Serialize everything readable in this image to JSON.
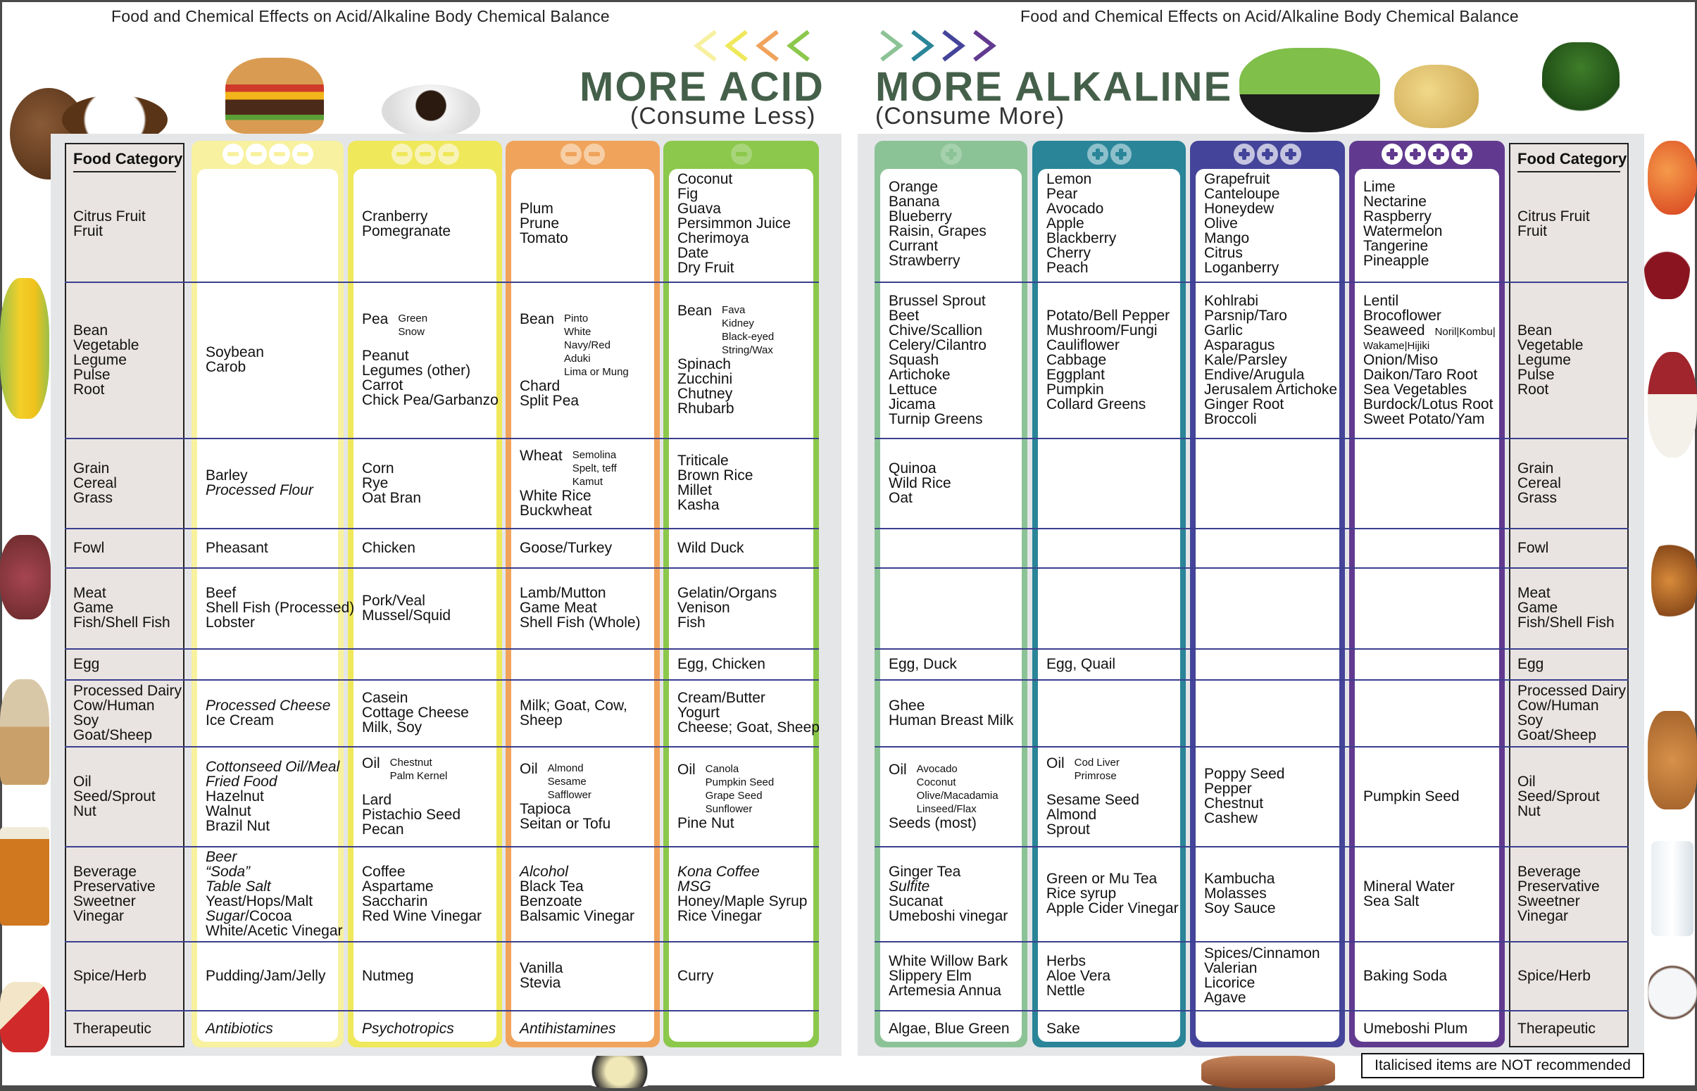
{
  "title": "Food and Chemical Effects on Acid/Alkaline Body Chemical Balance",
  "acid_side": {
    "heading": "MORE ACID",
    "subheading": "(Consume Less)",
    "chevron_colors": [
      "#f7f0a0",
      "#efe85a",
      "#f0a35b",
      "#8cc84b"
    ]
  },
  "alkaline_side": {
    "heading": "MORE ALKALINE",
    "subheading": "(Consume More)",
    "chevron_colors": [
      "#8cc396",
      "#2a8598",
      "#44449a",
      "#613a8f"
    ]
  },
  "category_header": "Food Category",
  "categories": [
    [
      "Citrus Fruit",
      "Fruit"
    ],
    [
      "Bean",
      "Vegetable",
      "Legume",
      "Pulse",
      "Root"
    ],
    [
      "Grain",
      "Cereal",
      "Grass"
    ],
    [
      "Fowl"
    ],
    [
      "Meat",
      "Game",
      "Fish/Shell Fish"
    ],
    [
      "Egg"
    ],
    [
      "Processed Dairy",
      "Cow/Human",
      "Soy",
      "Goat/Sheep"
    ],
    [
      "Oil",
      "Seed/Sprout",
      "Nut"
    ],
    [
      "Beverage",
      "Preservative",
      "Sweetner",
      "Vinegar"
    ],
    [
      "Spice/Herb"
    ],
    [
      "Therapeutic"
    ]
  ],
  "columns": [
    {
      "id": "acid-4",
      "sign": "minus",
      "level": 4,
      "color": "#f8f19f",
      "icon_bg": "#ffffff",
      "icon_fg": "#f8f19f",
      "cells": [
        [],
        [
          {
            "t": "Soybean"
          },
          {
            "t": "Carob"
          }
        ],
        [
          {
            "t": "Barley"
          },
          {
            "t": "Processed Flour",
            "i": true
          }
        ],
        [
          {
            "t": "Pheasant"
          }
        ],
        [
          {
            "t": "Beef"
          },
          {
            "t": "Shell Fish (Processed)"
          },
          {
            "t": "Lobster"
          }
        ],
        [],
        [
          {
            "t": "Processed Cheese",
            "i": true
          },
          {
            "t": "Ice Cream"
          }
        ],
        [
          {
            "t": "Cottonseed Oil/Meal",
            "i": true
          },
          {
            "t": "Fried Food",
            "i": true
          },
          {
            "t": "Hazelnut"
          },
          {
            "t": "Walnut"
          },
          {
            "t": "Brazil Nut"
          }
        ],
        [
          {
            "t": "Beer",
            "i": true
          },
          {
            "t": "“Soda”",
            "i": true
          },
          {
            "t": "Table Salt",
            "i": true
          },
          {
            "t": "Yeast/Hops/Malt"
          },
          {
            "t": "Sugar",
            "i": true,
            "rest": "/Cocoa"
          },
          {
            "t": "White/Acetic Vinegar"
          }
        ],
        [
          {
            "t": "Pudding/Jam/Jelly"
          }
        ],
        [
          {
            "t": "Antibiotics",
            "i": true
          }
        ]
      ]
    },
    {
      "id": "acid-3",
      "sign": "minus",
      "level": 3,
      "color": "#efe85a",
      "icon_bg": "#f8f3b8",
      "icon_fg": "#efe85a",
      "cells": [
        [
          {
            "t": "Cranberry"
          },
          {
            "t": "Pomegranate"
          }
        ],
        [
          {
            "t": "Pea",
            "sub": [
              "Green",
              "Snow"
            ]
          },
          {
            "t": ""
          },
          {
            "t": "Peanut"
          },
          {
            "t": "Legumes (other)"
          },
          {
            "t": "Carrot"
          },
          {
            "t": "Chick Pea/Garbanzo"
          }
        ],
        [
          {
            "t": "Corn"
          },
          {
            "t": "Rye"
          },
          {
            "t": "Oat Bran"
          }
        ],
        [
          {
            "t": "Chicken"
          }
        ],
        [
          {
            "t": "Pork/Veal"
          },
          {
            "t": "Mussel/Squid"
          }
        ],
        [],
        [
          {
            "t": "Casein"
          },
          {
            "t": "Cottage Cheese"
          },
          {
            "t": "Milk, Soy"
          }
        ],
        [
          {
            "t": "Oil",
            "sub": [
              "Chestnut",
              "Palm Kernel"
            ]
          },
          {
            "t": ""
          },
          {
            "t": "Lard"
          },
          {
            "t": "Pistachio Seed"
          },
          {
            "t": "Pecan"
          }
        ],
        [
          {
            "t": "Coffee"
          },
          {
            "t": "Aspartame"
          },
          {
            "t": "Saccharin"
          },
          {
            "t": "Red Wine Vinegar"
          }
        ],
        [
          {
            "t": "Nutmeg"
          }
        ],
        [
          {
            "t": "Psychotropics",
            "i": true
          }
        ]
      ]
    },
    {
      "id": "acid-2",
      "sign": "minus",
      "level": 2,
      "color": "#f0a35b",
      "icon_bg": "#f7cfa6",
      "icon_fg": "#f0a35b",
      "cells": [
        [
          {
            "t": "Plum"
          },
          {
            "t": "Prune"
          },
          {
            "t": "Tomato"
          }
        ],
        [
          {
            "t": "Bean",
            "sub": [
              "Pinto",
              "White",
              "Navy/Red",
              "Aduki",
              "Lima or Mung"
            ]
          },
          {
            "t": "Chard"
          },
          {
            "t": "Split Pea"
          }
        ],
        [
          {
            "t": "Wheat",
            "sub": [
              "Semolina",
              "Spelt, teff",
              "Kamut"
            ]
          },
          {
            "t": "White Rice"
          },
          {
            "t": "Buckwheat"
          }
        ],
        [
          {
            "t": "Goose/Turkey"
          }
        ],
        [
          {
            "t": "Lamb/Mutton"
          },
          {
            "t": "Game Meat"
          },
          {
            "t": "Shell Fish (Whole)"
          }
        ],
        [],
        [
          {
            "t": "Milk; Goat, Cow,"
          },
          {
            "t": "Sheep"
          }
        ],
        [
          {
            "t": "Oil",
            "sub": [
              "Almond",
              "Sesame",
              "Safflower"
            ]
          },
          {
            "t": "Tapioca"
          },
          {
            "t": "Seitan or Tofu"
          }
        ],
        [
          {
            "t": "Alcohol",
            "i": true
          },
          {
            "t": "Black Tea"
          },
          {
            "t": "Benzoate"
          },
          {
            "t": "Balsamic Vinegar"
          }
        ],
        [
          {
            "t": "Vanilla"
          },
          {
            "t": "Stevia"
          }
        ],
        [
          {
            "t": "Antihistamines",
            "i": true
          }
        ]
      ]
    },
    {
      "id": "acid-1",
      "sign": "minus",
      "level": 1,
      "color": "#8cc84b",
      "icon_bg": "#a8d57a",
      "icon_fg": "#8cc84b",
      "cells": [
        [
          {
            "t": "Coconut"
          },
          {
            "t": "Fig"
          },
          {
            "t": "Guava"
          },
          {
            "t": "Persimmon Juice"
          },
          {
            "t": "Cherimoya"
          },
          {
            "t": "Date"
          },
          {
            "t": "Dry Fruit"
          }
        ],
        [
          {
            "t": "Bean",
            "sub": [
              "Fava",
              "Kidney",
              "Black-eyed",
              "String/Wax"
            ]
          },
          {
            "t": "Spinach"
          },
          {
            "t": "Zucchini"
          },
          {
            "t": "Chutney"
          },
          {
            "t": "Rhubarb"
          }
        ],
        [
          {
            "t": "Triticale"
          },
          {
            "t": "Brown Rice"
          },
          {
            "t": "Millet"
          },
          {
            "t": "Kasha"
          }
        ],
        [
          {
            "t": "Wild Duck"
          }
        ],
        [
          {
            "t": "Gelatin/Organs"
          },
          {
            "t": "Venison"
          },
          {
            "t": "Fish"
          }
        ],
        [
          {
            "t": "Egg, Chicken"
          }
        ],
        [
          {
            "t": "Cream/Butter"
          },
          {
            "t": "Yogurt"
          },
          {
            "t": "Cheese;  Goat, Sheep"
          }
        ],
        [
          {
            "t": "Oil",
            "sub": [
              "Canola",
              "Pumpkin Seed",
              "Grape Seed",
              "Sunflower"
            ]
          },
          {
            "t": "Pine Nut"
          }
        ],
        [
          {
            "t": "Kona Coffee",
            "i": true
          },
          {
            "t": "MSG",
            "i": true
          },
          {
            "t": "Honey/Maple Syrup"
          },
          {
            "t": "Rice Vinegar"
          }
        ],
        [
          {
            "t": "Curry"
          }
        ],
        []
      ]
    },
    {
      "id": "alk-1",
      "sign": "plus",
      "level": 1,
      "color": "#8cc396",
      "icon_bg": "#a6d1ad",
      "icon_fg": "#8cc396",
      "cells": [
        [
          {
            "t": "Orange"
          },
          {
            "t": "Banana"
          },
          {
            "t": "Blueberry"
          },
          {
            "t": "Raisin, Grapes"
          },
          {
            "t": "Currant"
          },
          {
            "t": "Strawberry"
          }
        ],
        [
          {
            "t": "Brussel Sprout"
          },
          {
            "t": "Beet"
          },
          {
            "t": "Chive/Scallion"
          },
          {
            "t": "Celery/Cilantro"
          },
          {
            "t": "Squash"
          },
          {
            "t": "Artichoke"
          },
          {
            "t": "Lettuce"
          },
          {
            "t": "Jicama"
          },
          {
            "t": "Turnip Greens"
          }
        ],
        [
          {
            "t": "Quinoa"
          },
          {
            "t": "Wild Rice"
          },
          {
            "t": "Oat"
          }
        ],
        [],
        [],
        [
          {
            "t": "Egg, Duck"
          }
        ],
        [
          {
            "t": "Ghee"
          },
          {
            "t": "Human Breast Milk"
          }
        ],
        [
          {
            "t": "Oil",
            "sub": [
              "Avocado",
              "Coconut",
              "Olive/Macadamia",
              "Linseed/Flax"
            ]
          },
          {
            "t": "Seeds (most)"
          }
        ],
        [
          {
            "t": "Ginger Tea"
          },
          {
            "t": "Sulfite",
            "i": true
          },
          {
            "t": "Sucanat"
          },
          {
            "t": "Umeboshi vinegar"
          }
        ],
        [
          {
            "t": "White Willow Bark"
          },
          {
            "t": "Slippery Elm"
          },
          {
            "t": "Artemesia Annua"
          }
        ],
        [
          {
            "t": "Algae, Blue Green"
          }
        ]
      ]
    },
    {
      "id": "alk-2",
      "sign": "plus",
      "level": 2,
      "color": "#2a8598",
      "icon_bg": "#8ec0cc",
      "icon_fg": "#2a8598",
      "cells": [
        [
          {
            "t": "Lemon"
          },
          {
            "t": "Pear"
          },
          {
            "t": "Avocado"
          },
          {
            "t": "Apple"
          },
          {
            "t": "Blackberry"
          },
          {
            "t": "Cherry"
          },
          {
            "t": "Peach"
          }
        ],
        [
          {
            "t": "Potato/Bell Pepper"
          },
          {
            "t": "Mushroom/Fungi"
          },
          {
            "t": "Cauliflower"
          },
          {
            "t": "Cabbage"
          },
          {
            "t": "Eggplant"
          },
          {
            "t": "Pumpkin"
          },
          {
            "t": "Collard Greens"
          }
        ],
        [],
        [],
        [],
        [
          {
            "t": "Egg, Quail"
          }
        ],
        [],
        [
          {
            "t": "Oil",
            "sub": [
              "Cod Liver",
              "Primrose"
            ]
          },
          {
            "t": ""
          },
          {
            "t": "Sesame Seed"
          },
          {
            "t": "Almond"
          },
          {
            "t": "Sprout"
          }
        ],
        [
          {
            "t": "Green or Mu Tea"
          },
          {
            "t": "Rice syrup"
          },
          {
            "t": "Apple Cider Vinegar"
          }
        ],
        [
          {
            "t": "Herbs"
          },
          {
            "t": "Aloe Vera"
          },
          {
            "t": "Nettle"
          }
        ],
        [
          {
            "t": "Sake"
          }
        ]
      ]
    },
    {
      "id": "alk-3",
      "sign": "plus",
      "level": 3,
      "color": "#44449a",
      "icon_bg": "#c4c4e0",
      "icon_fg": "#44449a",
      "cells": [
        [
          {
            "t": "Grapefruit"
          },
          {
            "t": "Canteloupe"
          },
          {
            "t": "Honeydew"
          },
          {
            "t": "Olive"
          },
          {
            "t": "Mango"
          },
          {
            "t": "Citrus"
          },
          {
            "t": "Loganberry"
          }
        ],
        [
          {
            "t": "Kohlrabi"
          },
          {
            "t": "Parsnip/Taro"
          },
          {
            "t": "Garlic"
          },
          {
            "t": "Asparagus"
          },
          {
            "t": "Kale/Parsley"
          },
          {
            "t": "Endive/Arugula"
          },
          {
            "t": "Jerusalem Artichoke"
          },
          {
            "t": "Ginger Root"
          },
          {
            "t": "Broccoli"
          }
        ],
        [],
        [],
        [],
        [],
        [],
        [
          {
            "t": "Poppy Seed"
          },
          {
            "t": "Pepper"
          },
          {
            "t": "Chestnut"
          },
          {
            "t": "Cashew"
          }
        ],
        [
          {
            "t": "Kambucha"
          },
          {
            "t": "Molasses"
          },
          {
            "t": "Soy Sauce"
          }
        ],
        [
          {
            "t": "Spices/Cinnamon"
          },
          {
            "t": "Valerian"
          },
          {
            "t": "Licorice"
          },
          {
            "t": "Agave"
          }
        ],
        []
      ]
    },
    {
      "id": "alk-4",
      "sign": "plus",
      "level": 4,
      "color": "#613a8f",
      "icon_bg": "#ffffff",
      "icon_fg": "#613a8f",
      "cells": [
        [
          {
            "t": "Lime"
          },
          {
            "t": "Nectarine"
          },
          {
            "t": "Raspberry"
          },
          {
            "t": "Watermelon"
          },
          {
            "t": "Tangerine"
          },
          {
            "t": "Pineapple"
          }
        ],
        [
          {
            "t": "Lentil"
          },
          {
            "t": "Brocoflower"
          },
          {
            "t": "Seaweed",
            "inline": "Noril|Kombu|"
          },
          {
            "t": "Wakame|Hijiki",
            "small": true
          },
          {
            "t": "Onion/Miso"
          },
          {
            "t": "Daikon/Taro Root"
          },
          {
            "t": "Sea Vegetables"
          },
          {
            "t": "Burdock/Lotus Root"
          },
          {
            "t": "Sweet Potato/Yam"
          }
        ],
        [],
        [],
        [],
        [],
        [],
        [
          {
            "t": "Pumpkin Seed"
          }
        ],
        [
          {
            "t": "Mineral Water"
          },
          {
            "t": "Sea Salt"
          }
        ],
        [
          {
            "t": "Baking Soda"
          }
        ],
        [
          {
            "t": "Umeboshi Plum"
          }
        ]
      ]
    }
  ],
  "footnote": "Italicised items are NOT recommended",
  "decorative_images": [
    "coconut",
    "hamburger",
    "coffee-cup",
    "salad-bowl",
    "potatoes",
    "broccoli",
    "corn",
    "meat",
    "ice-cream",
    "beer",
    "pills",
    "vanilla",
    "cinnamon",
    "peach",
    "cherries",
    "onion",
    "almonds",
    "water-glass",
    "sea-salt"
  ]
}
